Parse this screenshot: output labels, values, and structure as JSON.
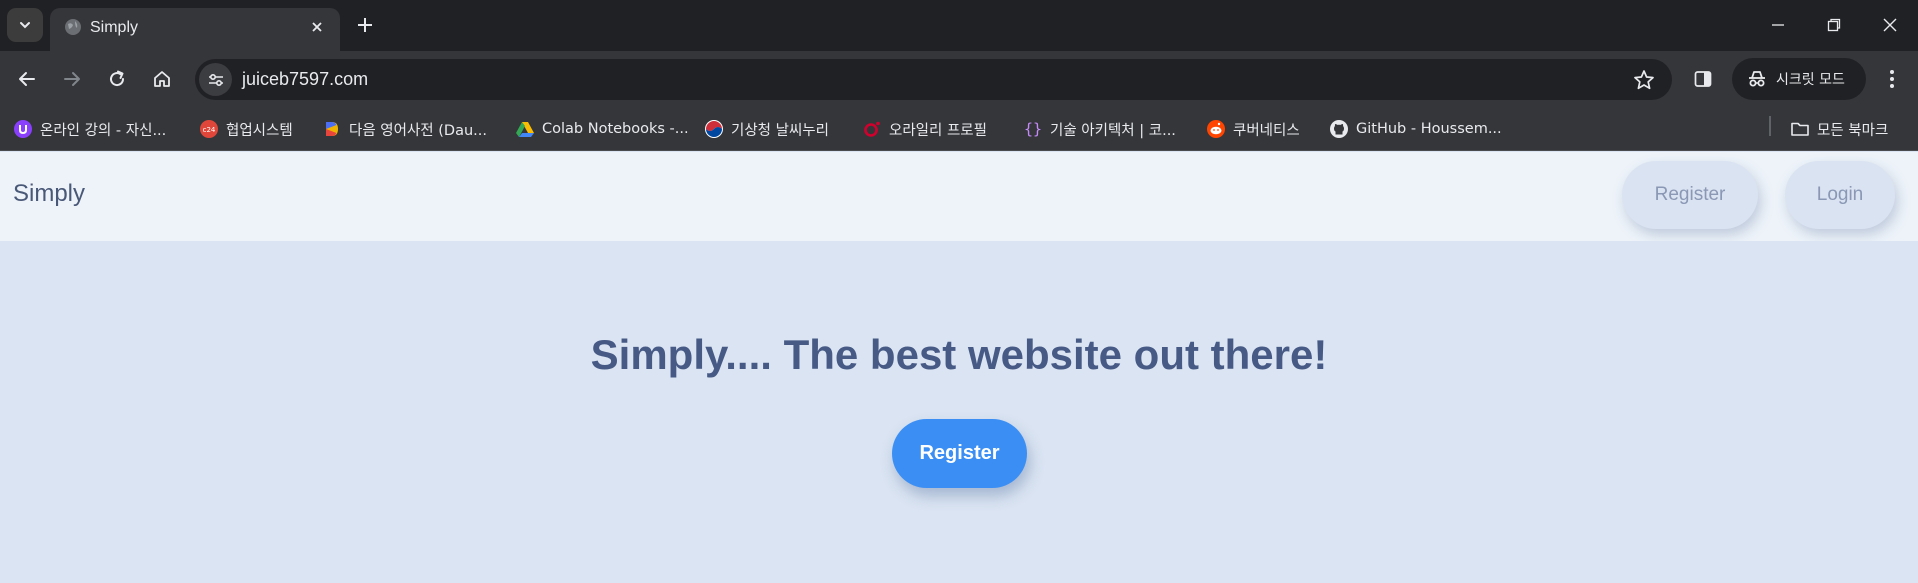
{
  "browser": {
    "tab": {
      "title": "Simply"
    },
    "address_bar": {
      "url": "juiceb7597.com"
    },
    "incognito_label": "시크릿 모드",
    "bookmarks": [
      {
        "label": "온라인 강의 - 자신...",
        "icon": "inflearn-icon",
        "color": "#8a3ffc"
      },
      {
        "label": "협업시스템",
        "icon": "cafe24-icon",
        "color": "#e0473a"
      },
      {
        "label": "다음 영어사전 (Dau...",
        "icon": "daum-icon",
        "color": "#f0b400"
      },
      {
        "label": "Colab Notebooks -...",
        "icon": "google-drive-icon",
        "color": "#34a853"
      },
      {
        "label": "기상청 날씨누리",
        "icon": "kma-icon",
        "color": "#cd2e3a"
      },
      {
        "label": "오라일리 프로필",
        "icon": "oreilly-icon",
        "color": "#d3002d"
      },
      {
        "label": "기술 아키텍처 | 코...",
        "icon": "braces-icon",
        "color": "#c58af9"
      },
      {
        "label": "쿠버네티스",
        "icon": "reddit-icon",
        "color": "#ff4500"
      },
      {
        "label": "GitHub - Houssem...",
        "icon": "github-icon",
        "color": "#e8eaed"
      }
    ],
    "all_bookmarks_label": "모든 북마크"
  },
  "site": {
    "brand": "Simply",
    "nav": {
      "register": "Register",
      "login": "Login"
    },
    "hero": {
      "title": "Simply.... The best website out there!",
      "cta": "Register"
    }
  },
  "colors": {
    "accent": "#3b8ff4",
    "heading": "#475a86",
    "hero_bg": "#dae4f2",
    "navbar_bg": "#edf3f9"
  }
}
